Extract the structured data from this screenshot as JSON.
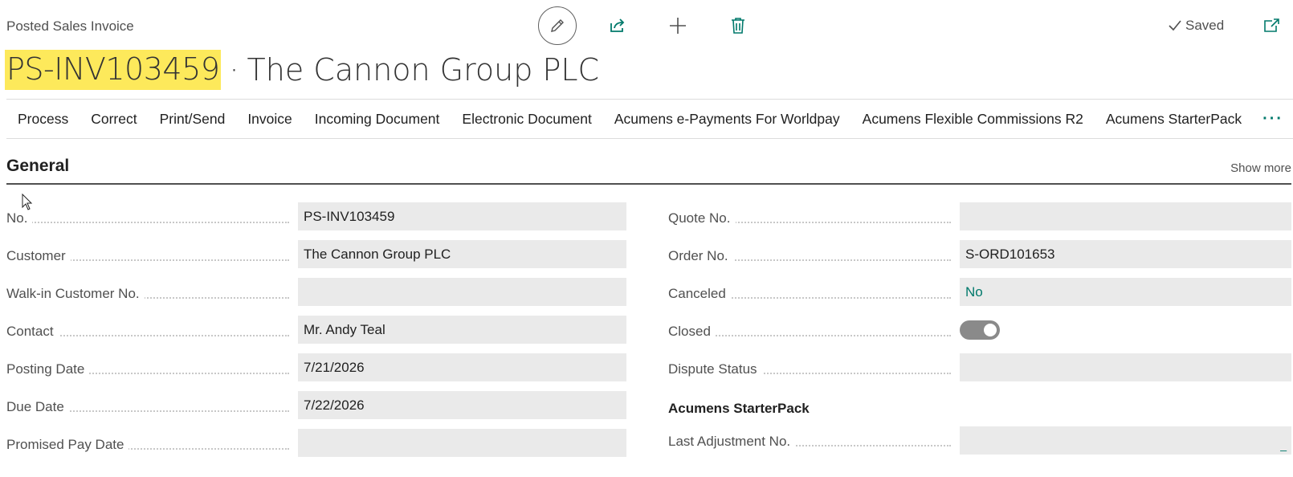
{
  "header": {
    "page_type": "Posted Sales Invoice",
    "saved_label": "Saved",
    "title_no": "PS-INV103459",
    "title_sep": "·",
    "title_name": "The Cannon Group PLC",
    "highlight_color": "#fde95b",
    "icons": [
      "edit-icon",
      "share-icon",
      "new-icon",
      "delete-icon",
      "checkmark-icon",
      "open-new-window-icon"
    ]
  },
  "actions": {
    "items": [
      "Process",
      "Correct",
      "Print/Send",
      "Invoice",
      "Incoming Document",
      "Electronic Document",
      "Acumens e-Payments For Worldpay",
      "Acumens Flexible Commissions R2",
      "Acumens StarterPack"
    ],
    "more": "···"
  },
  "general": {
    "title": "General",
    "show_more": "Show more",
    "left": [
      {
        "label": "No.",
        "value": "PS-INV103459"
      },
      {
        "label": "Customer",
        "value": "The Cannon Group PLC"
      },
      {
        "label": "Walk-in Customer No.",
        "value": ""
      },
      {
        "label": "Contact",
        "value": "Mr. Andy Teal"
      },
      {
        "label": "Posting Date",
        "value": "7/21/2026"
      },
      {
        "label": "Due Date",
        "value": "7/22/2026"
      },
      {
        "label": "Promised Pay Date",
        "value": ""
      }
    ],
    "right": {
      "quote_no": {
        "label": "Quote No.",
        "value": ""
      },
      "order_no": {
        "label": "Order No.",
        "value": "S-ORD101653"
      },
      "canceled": {
        "label": "Canceled",
        "value": "No"
      },
      "closed": {
        "label": "Closed",
        "value": true
      },
      "dispute_status": {
        "label": "Dispute Status",
        "value": ""
      },
      "subgroup_title": "Acumens StarterPack",
      "last_adjustment_no": {
        "label": "Last Adjustment No.",
        "value": "",
        "tail": "_"
      }
    }
  },
  "colors": {
    "accent": "#00796b",
    "field_bg": "#eaeaea",
    "label": "#505050"
  }
}
